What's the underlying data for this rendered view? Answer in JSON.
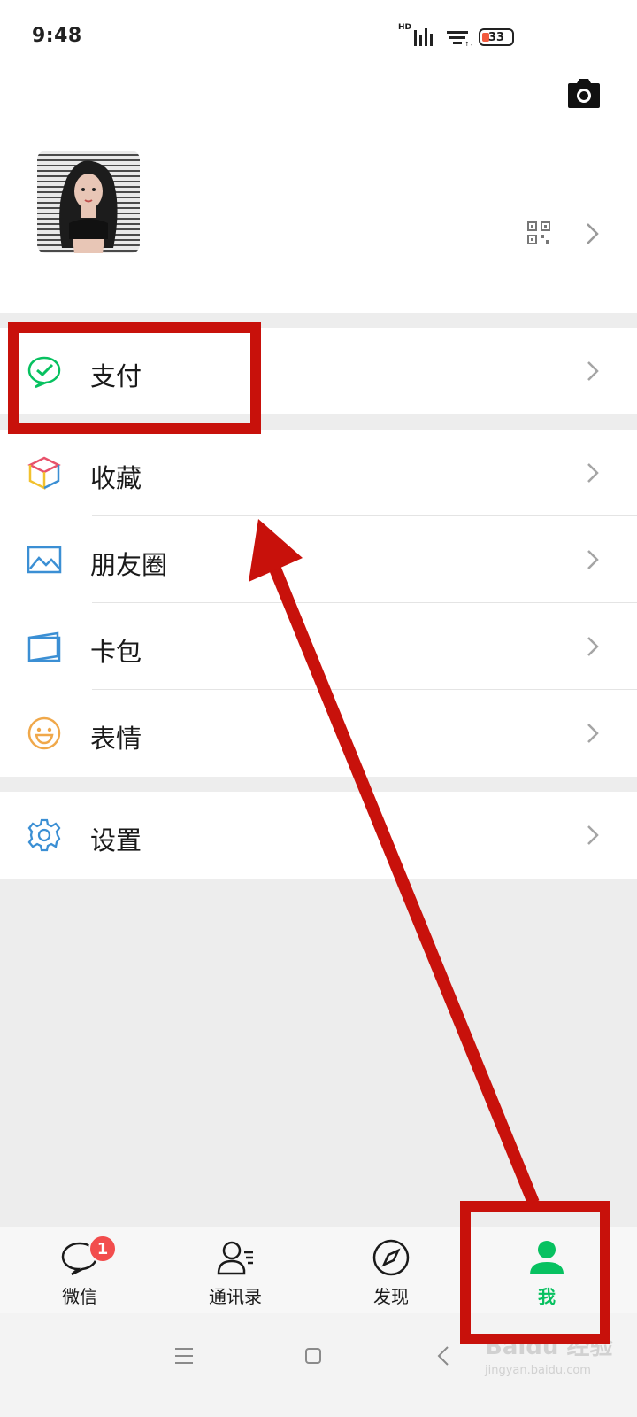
{
  "status_bar": {
    "time": "9:48",
    "network_label": "HD",
    "battery_level": "33"
  },
  "header": {
    "camera_icon": "camera-icon",
    "qr_icon": "qr-code-icon"
  },
  "menu": {
    "pay": {
      "label": "支付",
      "icon": "wechat-pay-icon",
      "color": "#07c160"
    },
    "favorites": {
      "label": "收藏",
      "icon": "cube-icon"
    },
    "moments": {
      "label": "朋友圈",
      "icon": "photo-icon",
      "color": "#3b8fd4"
    },
    "cards": {
      "label": "卡包",
      "icon": "card-wallet-icon",
      "color": "#3b8fd4"
    },
    "stickers": {
      "label": "表情",
      "icon": "smiley-icon",
      "color": "#f0a84a"
    },
    "settings": {
      "label": "设置",
      "icon": "gear-icon",
      "color": "#3b8fd4"
    }
  },
  "tabbar": {
    "tabs": [
      {
        "label": "微信",
        "icon": "chat-bubble-icon",
        "badge": "1",
        "active": false
      },
      {
        "label": "通讯录",
        "icon": "contacts-icon",
        "active": false
      },
      {
        "label": "发现",
        "icon": "compass-icon",
        "active": false
      },
      {
        "label": "我",
        "icon": "person-icon",
        "active": true
      }
    ],
    "active_color": "#07c160"
  },
  "watermark": {
    "text": "Baidu 经验",
    "sub": "jingyan.baidu.com"
  },
  "annotation_color": "#c8110b"
}
